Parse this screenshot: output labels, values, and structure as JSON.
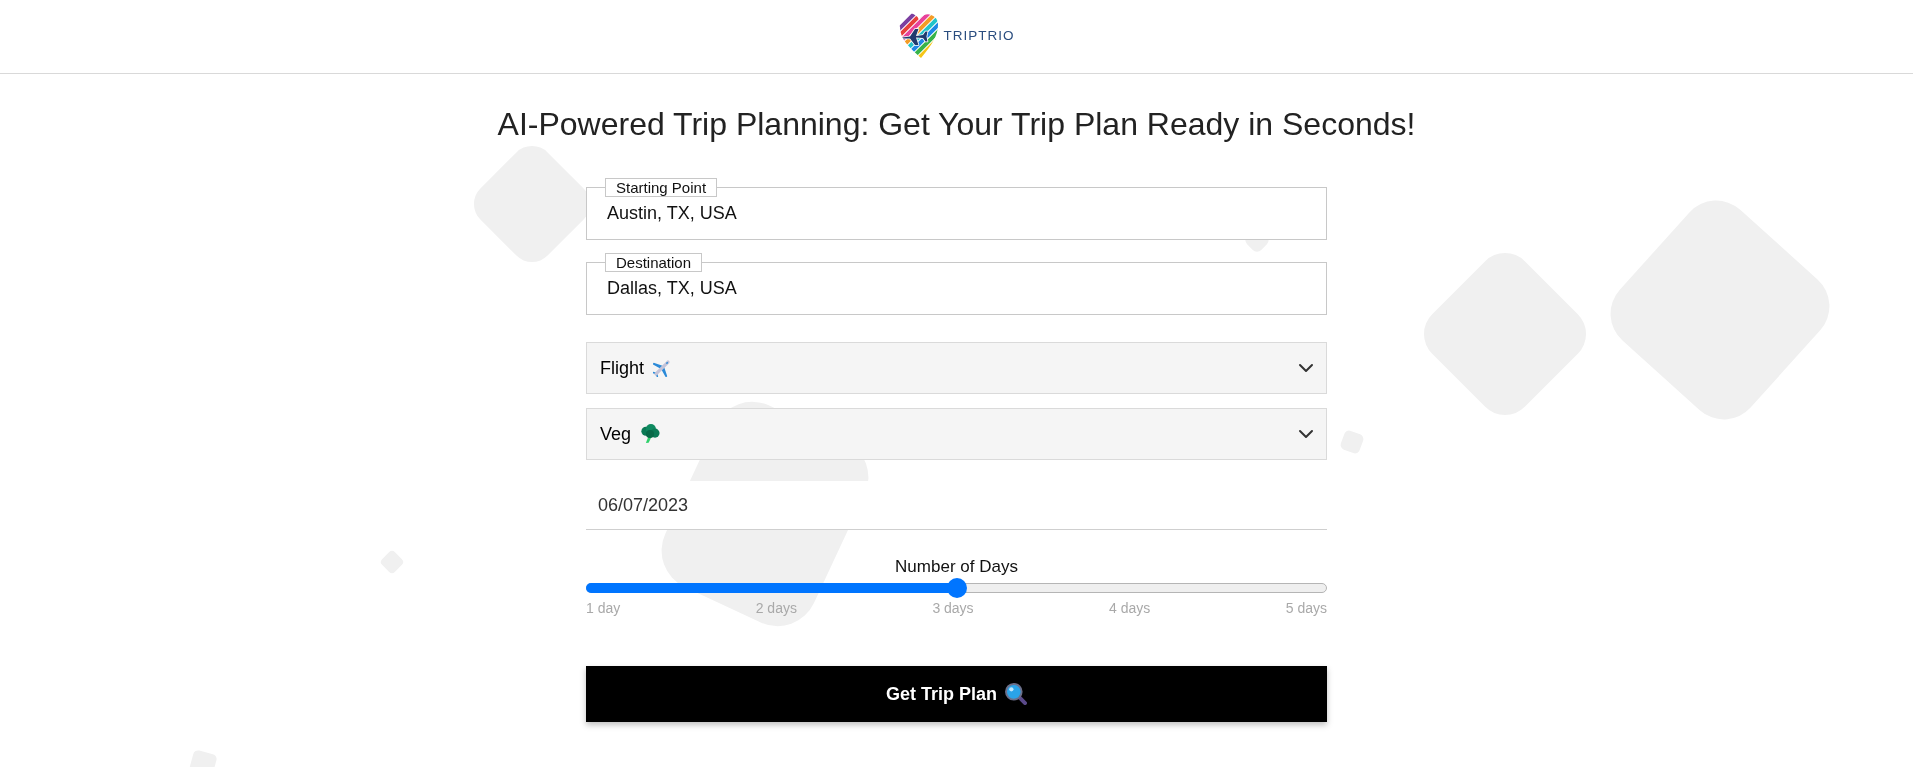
{
  "header": {
    "logo_text": "TRIPTRIO"
  },
  "title": "AI-Powered Trip Planning: Get Your Trip Plan Ready in Seconds!",
  "form": {
    "location_fields": [
      {
        "label": "Starting Point",
        "value": "Austin, TX, USA"
      },
      {
        "label": "Destination",
        "value": "Dallas, TX, USA"
      }
    ],
    "selects": [
      {
        "kind": "transport",
        "value": "Flight"
      },
      {
        "kind": "diet",
        "value": "Veg"
      }
    ],
    "date_field": {
      "value": "06/07/2023"
    },
    "days_slider": {
      "label": "Number of Days",
      "level": 0.5,
      "ticks": [
        "1 day",
        "2 days",
        "3 days",
        "4 days",
        "5 days"
      ]
    },
    "submit_button": {
      "label": "Get Trip Plan"
    }
  }
}
